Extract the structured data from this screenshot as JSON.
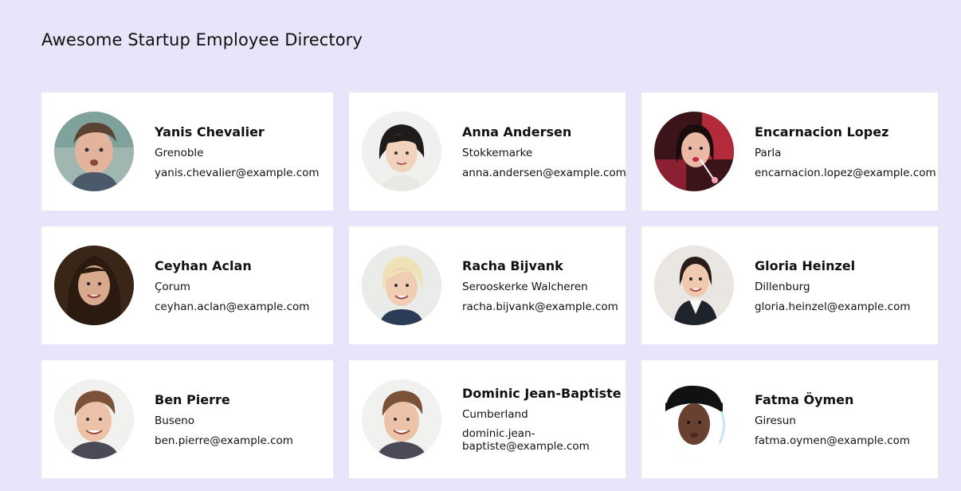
{
  "page": {
    "title": "Awesome Startup Employee Directory"
  },
  "employees": [
    {
      "name": "Yanis Chevalier",
      "city": "Grenoble",
      "email": "yanis.chevalier@example.com",
      "avatar": "man-portrait-icon"
    },
    {
      "name": "Anna Andersen",
      "city": "Stokkemarke",
      "email": "anna.andersen@example.com",
      "avatar": "woman-portrait-icon"
    },
    {
      "name": "Encarnacion Lopez",
      "city": "Parla",
      "email": "encarnacion.lopez@example.com",
      "avatar": "woman-portrait-icon"
    },
    {
      "name": "Ceyhan Aclan",
      "city": "Çorum",
      "email": "ceyhan.aclan@example.com",
      "avatar": "woman-portrait-icon"
    },
    {
      "name": "Racha Bijvank",
      "city": "Serooskerke Walcheren",
      "email": "racha.bijvank@example.com",
      "avatar": "woman-portrait-icon"
    },
    {
      "name": "Gloria Heinzel",
      "city": "Dillenburg",
      "email": "gloria.heinzel@example.com",
      "avatar": "woman-portrait-icon"
    },
    {
      "name": "Ben Pierre",
      "city": "Buseno",
      "email": "ben.pierre@example.com",
      "avatar": "man-portrait-icon"
    },
    {
      "name": "Dominic Jean-Baptiste",
      "city": "Cumberland",
      "email": "dominic.jean-baptiste@example.com",
      "avatar": "man-portrait-icon"
    },
    {
      "name": "Fatma Öymen",
      "city": "Giresun",
      "email": "fatma.oymen@example.com",
      "avatar": "woman-portrait-icon"
    }
  ],
  "colors": {
    "background": "#e6e5f9",
    "card": "#ffffff",
    "text": "#111111"
  }
}
